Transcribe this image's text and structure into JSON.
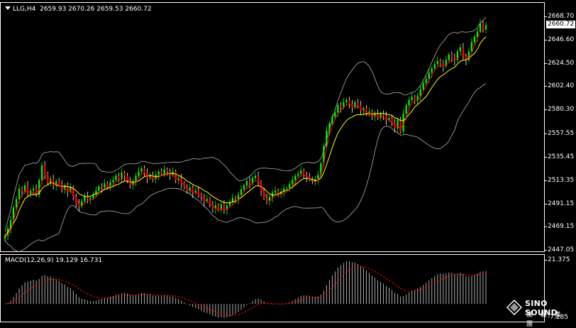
{
  "chart_header": {
    "symbol_label": "LLG,H4",
    "ohlc": "2659.93 2670.26 2659.53 2660.72"
  },
  "current_price": "2660.72",
  "price_axis": [
    "2668.70",
    "2646.60",
    "2624.50",
    "2602.40",
    "2580.30",
    "2557.55",
    "2535.45",
    "2513.35",
    "2491.15",
    "2469.15",
    "2447.05"
  ],
  "macd": {
    "label": "MACD(12,26,9) 19.129 16.731",
    "axis_top": "21.375",
    "axis_bottom": "-7.285"
  },
  "watermark": {
    "brand": "SINO SOUND",
    "brand_cn": "漢 聲 集 團"
  },
  "colors": {
    "up_candle": "#00ff00",
    "down_candle": "#ff0000",
    "ma_line": "#ffff00",
    "bollinger": "#b0b0b0",
    "macd_signal": "#ff0000",
    "macd_hist": "#c0c0c0"
  },
  "chart_data": [
    {
      "type": "line",
      "title": "",
      "description_source": "estimated from price axis",
      "x": [
        0,
        1,
        2,
        3,
        4,
        5,
        6,
        7,
        8,
        9,
        10,
        11,
        12,
        13,
        14,
        15,
        16,
        17,
        18,
        19,
        20,
        21,
        22,
        23,
        24,
        25,
        26,
        27,
        28,
        29,
        30,
        31,
        32,
        33,
        34,
        35,
        36,
        37,
        38,
        39,
        40,
        41,
        42,
        43,
        44,
        45,
        46,
        47,
        48,
        49,
        50,
        51,
        52,
        53,
        54,
        55,
        56,
        57,
        58,
        59,
        60,
        61,
        62,
        63,
        64,
        65,
        66,
        67,
        68,
        69,
        70,
        71,
        72,
        73,
        74,
        75,
        76,
        77,
        78,
        79,
        80,
        81,
        82,
        83,
        84,
        85,
        86,
        87,
        88,
        89,
        90,
        91,
        92,
        93,
        94,
        95,
        96,
        97,
        98,
        99,
        100,
        101,
        102,
        103,
        104,
        105,
        106,
        107,
        108,
        109,
        110,
        111,
        112,
        113,
        114,
        115,
        116,
        117,
        118,
        119,
        120,
        121,
        122,
        123,
        124,
        125,
        126,
        127,
        128,
        129,
        130,
        131,
        132,
        133,
        134,
        135,
        136,
        137,
        138,
        139,
        140,
        141,
        142,
        143,
        144,
        145,
        146,
        147,
        148,
        149,
        150,
        151,
        152,
        153,
        154,
        155,
        156,
        157,
        158,
        159,
        160,
        161,
        162,
        163,
        164,
        165,
        166,
        167,
        168,
        169
      ],
      "series": [
        {
          "close": [
            2461,
            2468,
            2476,
            2488,
            2496,
            2506,
            2503,
            2509,
            2501,
            2504,
            2506,
            2500,
            2514,
            2528,
            2520,
            2511,
            2515,
            2509,
            2513,
            2510,
            2505,
            2509,
            2503,
            2507,
            2498,
            2492,
            2489,
            2494,
            2499,
            2496,
            2497,
            2500,
            2504,
            2508,
            2507,
            2511,
            2508,
            2512,
            2514,
            2518,
            2515,
            2521,
            2518,
            2513,
            2509,
            2513,
            2518,
            2522,
            2525,
            2521,
            2516,
            2519,
            2515,
            2519,
            2522,
            2520,
            2524,
            2522,
            2519,
            2522,
            2514,
            2516,
            2511,
            2507,
            2504,
            2507,
            2502,
            2504,
            2500,
            2498,
            2494,
            2496,
            2491,
            2487,
            2490,
            2486,
            2491,
            2486,
            2490,
            2493,
            2497,
            2496,
            2500,
            2505,
            2509,
            2513,
            2511,
            2516,
            2518,
            2512,
            2504,
            2497,
            2494,
            2498,
            2502,
            2504,
            2501,
            2503,
            2506,
            2506,
            2510,
            2514,
            2518,
            2520,
            2523,
            2519,
            2517,
            2515,
            2513,
            2515,
            2519,
            2530,
            2546,
            2561,
            2568,
            2574,
            2578,
            2585,
            2583,
            2588,
            2590,
            2586,
            2583,
            2588,
            2585,
            2580,
            2582,
            2577,
            2579,
            2575,
            2577,
            2573,
            2577,
            2575,
            2571,
            2573,
            2568,
            2563,
            2571,
            2560,
            2577,
            2585,
            2590,
            2593,
            2589,
            2594,
            2600,
            2606,
            2610,
            2616,
            2620,
            2624,
            2627,
            2625,
            2622,
            2628,
            2633,
            2630,
            2628,
            2636,
            2640,
            2632,
            2628,
            2636,
            2645,
            2650,
            2655,
            2663,
            2657,
            2661
          ],
          "name": ""
        }
      ]
    }
  ]
}
